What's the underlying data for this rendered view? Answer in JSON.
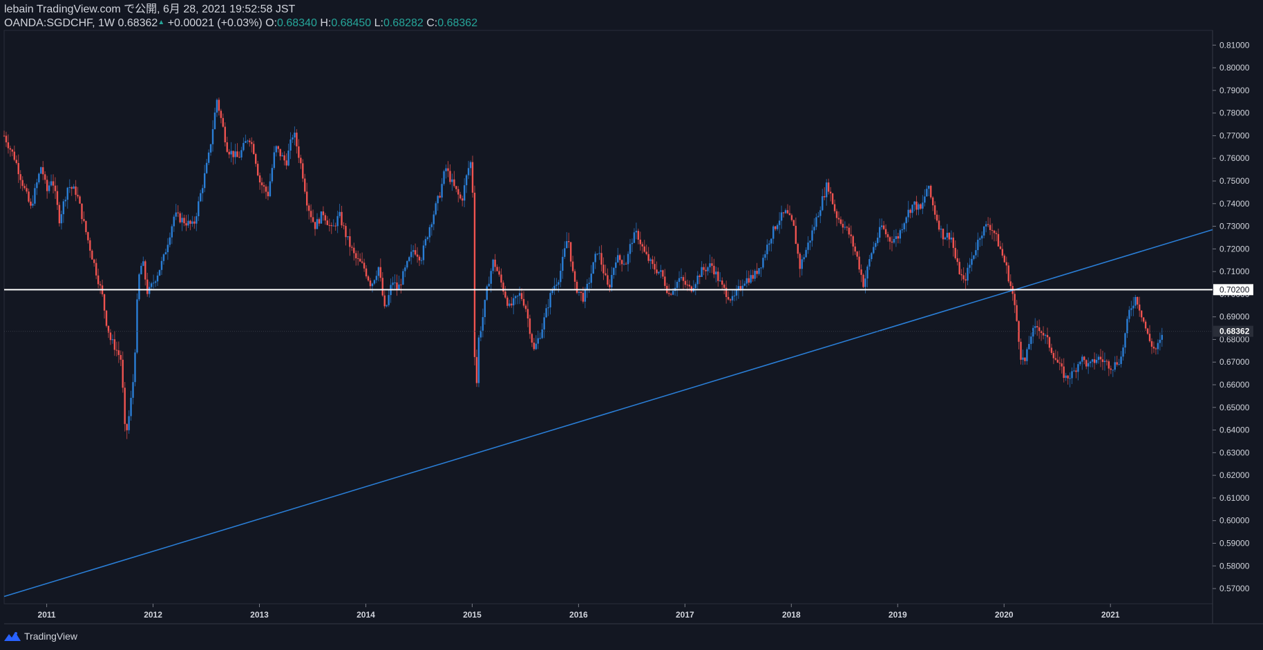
{
  "header": {
    "publish_line": "lebain TradingView.com で公開, 6月 28, 2021 19:52:58 JST",
    "symbol": "OANDA:SGDCHF, 1W",
    "last_price": "0.68362",
    "change_arrow": "▲",
    "change": "+0.00021 (+0.03%)",
    "o_label": "O:",
    "o_value": "0.68340",
    "h_label": "H:",
    "h_value": "0.68450",
    "l_label": "L:",
    "l_value": "0.68282",
    "c_label": "C:",
    "c_value": "0.68362"
  },
  "footer": {
    "brand": "TradingView",
    "logo_icon": "tradingview-logo-icon"
  },
  "colors": {
    "background": "#131722",
    "up": "#2a7ed6",
    "down": "#ef5350",
    "trendline": "#2a7ed6",
    "horizontal_line": "#ffffff",
    "text": "#d1d4dc"
  },
  "chart_data": {
    "type": "candlestick",
    "title": "OANDA:SGDCHF, 1W",
    "y_axis": {
      "ticks": [
        "0.81000",
        "0.80000",
        "0.79000",
        "0.78000",
        "0.77000",
        "0.76000",
        "0.75000",
        "0.74000",
        "0.73000",
        "0.72000",
        "0.71000",
        "0.70000",
        "0.69000",
        "0.68000",
        "0.67000",
        "0.66000",
        "0.65000",
        "0.64000",
        "0.63000",
        "0.62000",
        "0.61000",
        "0.60000",
        "0.59000",
        "0.58000",
        "0.57000"
      ],
      "range": [
        0.5633,
        0.8165
      ]
    },
    "x_axis": {
      "ticks": [
        "2011",
        "2012",
        "2013",
        "2014",
        "2015",
        "2016",
        "2017",
        "2018",
        "2019",
        "2020",
        "2021"
      ],
      "range": [
        2010.6,
        2021.96
      ]
    },
    "price_labels": {
      "horizontal_level": "0.70200",
      "current_price": "0.68362"
    },
    "horizontal_line": {
      "price": 0.702
    },
    "trendline": {
      "points": [
        [
          2010.6,
          0.5665
        ],
        [
          2021.96,
          0.7285
        ]
      ]
    },
    "close_path": [
      [
        2010.6,
        0.77
      ],
      [
        2010.7,
        0.76
      ],
      [
        2010.8,
        0.745
      ],
      [
        2010.85,
        0.738
      ],
      [
        2010.95,
        0.757
      ],
      [
        2011.0,
        0.745
      ],
      [
        2011.05,
        0.752
      ],
      [
        2011.12,
        0.733
      ],
      [
        2011.2,
        0.748
      ],
      [
        2011.28,
        0.745
      ],
      [
        2011.35,
        0.731
      ],
      [
        2011.42,
        0.718
      ],
      [
        2011.47,
        0.709
      ],
      [
        2011.52,
        0.7
      ],
      [
        2011.56,
        0.688
      ],
      [
        2011.6,
        0.68
      ],
      [
        2011.65,
        0.676
      ],
      [
        2011.7,
        0.671
      ],
      [
        2011.74,
        0.636
      ],
      [
        2011.78,
        0.648
      ],
      [
        2011.82,
        0.665
      ],
      [
        2011.86,
        0.706
      ],
      [
        2011.9,
        0.715
      ],
      [
        2011.95,
        0.7
      ],
      [
        2012.05,
        0.71
      ],
      [
        2012.1,
        0.716
      ],
      [
        2012.2,
        0.735
      ],
      [
        2012.3,
        0.732
      ],
      [
        2012.38,
        0.73
      ],
      [
        2012.45,
        0.745
      ],
      [
        2012.52,
        0.76
      ],
      [
        2012.6,
        0.786
      ],
      [
        2012.7,
        0.764
      ],
      [
        2012.8,
        0.76
      ],
      [
        2012.9,
        0.77
      ],
      [
        2012.95,
        0.763
      ],
      [
        2013.0,
        0.75
      ],
      [
        2013.08,
        0.744
      ],
      [
        2013.15,
        0.765
      ],
      [
        2013.25,
        0.758
      ],
      [
        2013.32,
        0.772
      ],
      [
        2013.4,
        0.755
      ],
      [
        2013.45,
        0.74
      ],
      [
        2013.52,
        0.73
      ],
      [
        2013.6,
        0.736
      ],
      [
        2013.68,
        0.728
      ],
      [
        2013.75,
        0.735
      ],
      [
        2013.82,
        0.725
      ],
      [
        2013.9,
        0.716
      ],
      [
        2013.98,
        0.712
      ],
      [
        2014.05,
        0.704
      ],
      [
        2014.12,
        0.712
      ],
      [
        2014.18,
        0.692
      ],
      [
        2014.25,
        0.706
      ],
      [
        2014.3,
        0.702
      ],
      [
        2014.38,
        0.712
      ],
      [
        2014.45,
        0.72
      ],
      [
        2014.52,
        0.716
      ],
      [
        2014.6,
        0.73
      ],
      [
        2014.7,
        0.745
      ],
      [
        2014.75,
        0.756
      ],
      [
        2014.82,
        0.748
      ],
      [
        2014.9,
        0.741
      ],
      [
        2014.96,
        0.755
      ],
      [
        2015.0,
        0.76
      ],
      [
        2015.03,
        0.648
      ],
      [
        2015.06,
        0.68
      ],
      [
        2015.1,
        0.69
      ],
      [
        2015.15,
        0.705
      ],
      [
        2015.2,
        0.715
      ],
      [
        2015.28,
        0.704
      ],
      [
        2015.35,
        0.694
      ],
      [
        2015.45,
        0.7
      ],
      [
        2015.5,
        0.695
      ],
      [
        2015.58,
        0.675
      ],
      [
        2015.65,
        0.684
      ],
      [
        2015.75,
        0.702
      ],
      [
        2015.82,
        0.708
      ],
      [
        2015.9,
        0.726
      ],
      [
        2015.96,
        0.704
      ],
      [
        2016.05,
        0.698
      ],
      [
        2016.1,
        0.706
      ],
      [
        2016.18,
        0.72
      ],
      [
        2016.28,
        0.702
      ],
      [
        2016.35,
        0.716
      ],
      [
        2016.45,
        0.714
      ],
      [
        2016.5,
        0.724
      ],
      [
        2016.55,
        0.727
      ],
      [
        2016.62,
        0.718
      ],
      [
        2016.7,
        0.712
      ],
      [
        2016.78,
        0.709
      ],
      [
        2016.85,
        0.7
      ],
      [
        2016.95,
        0.707
      ],
      [
        2017.05,
        0.702
      ],
      [
        2017.15,
        0.71
      ],
      [
        2017.25,
        0.713
      ],
      [
        2017.35,
        0.703
      ],
      [
        2017.45,
        0.697
      ],
      [
        2017.55,
        0.706
      ],
      [
        2017.65,
        0.708
      ],
      [
        2017.72,
        0.714
      ],
      [
        2017.8,
        0.725
      ],
      [
        2017.88,
        0.733
      ],
      [
        2017.95,
        0.736
      ],
      [
        2018.02,
        0.73
      ],
      [
        2018.08,
        0.712
      ],
      [
        2018.18,
        0.725
      ],
      [
        2018.28,
        0.74
      ],
      [
        2018.34,
        0.749
      ],
      [
        2018.42,
        0.735
      ],
      [
        2018.5,
        0.73
      ],
      [
        2018.55,
        0.726
      ],
      [
        2018.62,
        0.716
      ],
      [
        2018.68,
        0.704
      ],
      [
        2018.75,
        0.718
      ],
      [
        2018.85,
        0.73
      ],
      [
        2018.92,
        0.724
      ],
      [
        2019.0,
        0.725
      ],
      [
        2019.08,
        0.735
      ],
      [
        2019.15,
        0.74
      ],
      [
        2019.22,
        0.737
      ],
      [
        2019.28,
        0.748
      ],
      [
        2019.35,
        0.736
      ],
      [
        2019.42,
        0.726
      ],
      [
        2019.5,
        0.726
      ],
      [
        2019.55,
        0.714
      ],
      [
        2019.62,
        0.705
      ],
      [
        2019.7,
        0.716
      ],
      [
        2019.78,
        0.727
      ],
      [
        2019.85,
        0.731
      ],
      [
        2019.9,
        0.728
      ],
      [
        2019.95,
        0.722
      ],
      [
        2020.02,
        0.712
      ],
      [
        2020.08,
        0.7
      ],
      [
        2020.12,
        0.688
      ],
      [
        2020.16,
        0.672
      ],
      [
        2020.2,
        0.67
      ],
      [
        2020.25,
        0.682
      ],
      [
        2020.32,
        0.686
      ],
      [
        2020.4,
        0.68
      ],
      [
        2020.45,
        0.675
      ],
      [
        2020.52,
        0.668
      ],
      [
        2020.58,
        0.663
      ],
      [
        2020.65,
        0.665
      ],
      [
        2020.72,
        0.672
      ],
      [
        2020.8,
        0.668
      ],
      [
        2020.88,
        0.672
      ],
      [
        2020.95,
        0.67
      ],
      [
        2021.02,
        0.668
      ],
      [
        2021.1,
        0.672
      ],
      [
        2021.18,
        0.693
      ],
      [
        2021.24,
        0.699
      ],
      [
        2021.3,
        0.69
      ],
      [
        2021.36,
        0.68
      ],
      [
        2021.42,
        0.675
      ],
      [
        2021.48,
        0.68
      ],
      [
        2021.5,
        0.6836
      ]
    ]
  }
}
